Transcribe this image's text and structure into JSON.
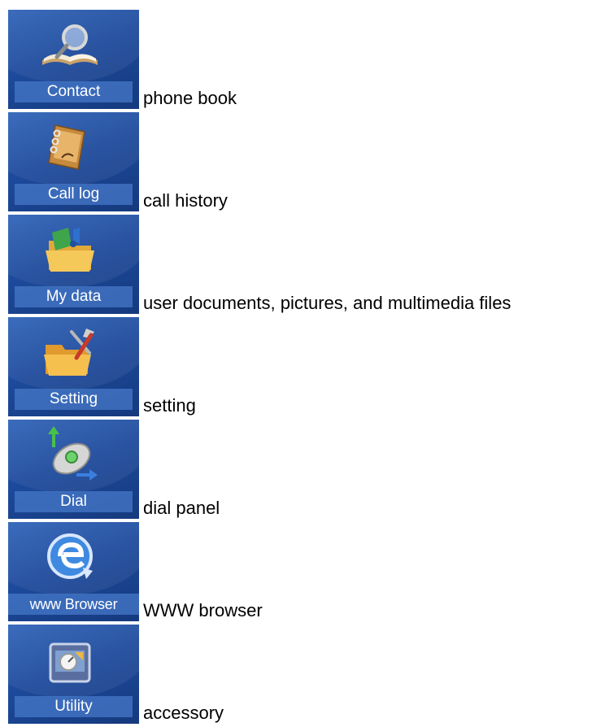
{
  "menu": {
    "items": [
      {
        "label": "Contact",
        "description": "phone book",
        "icon": "book-magnifier-icon"
      },
      {
        "label": "Call log",
        "description": "call history",
        "icon": "notebook-icon"
      },
      {
        "label": "My data",
        "description": "user documents, pictures, and multimedia files",
        "icon": "media-folder-icon"
      },
      {
        "label": "Setting",
        "description": "setting",
        "icon": "folder-tools-icon"
      },
      {
        "label": "Dial",
        "description": "dial panel",
        "icon": "phone-arrows-icon"
      },
      {
        "label": "www Browser",
        "description": "WWW browser",
        "icon": "browser-globe-icon"
      },
      {
        "label": "Utility",
        "description": "accessory",
        "icon": "toolbox-icon"
      }
    ]
  }
}
